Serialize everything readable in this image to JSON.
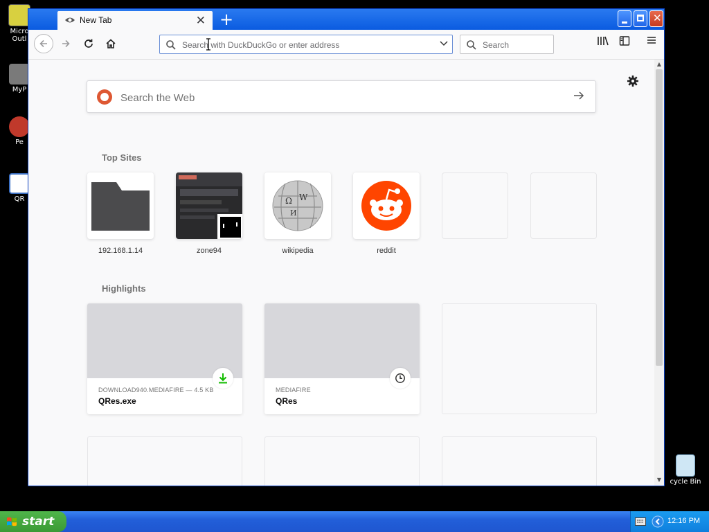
{
  "desktop": {
    "icons": [
      {
        "label": "Micro\nOutl",
        "color": "#d8d040"
      },
      {
        "label": "MyP",
        "color": "#7a7a7a"
      },
      {
        "label": "Pe",
        "color": "#c0392b"
      },
      {
        "label": "QR",
        "color": "#3b6fc2"
      }
    ],
    "recycle_label": "cycle Bin"
  },
  "browser": {
    "tab_title": "New Tab",
    "url_placeholder": "Search with DuckDuckGo or enter address",
    "search_placeholder": "Search"
  },
  "newtab": {
    "web_search_placeholder": "Search the Web",
    "top_sites_title": "Top Sites",
    "top_sites": [
      {
        "label": "192.168.1.14",
        "kind": "folder"
      },
      {
        "label": "zone94",
        "kind": "screenshot"
      },
      {
        "label": "wikipedia",
        "kind": "wikipedia"
      },
      {
        "label": "reddit",
        "kind": "reddit"
      },
      {
        "label": "",
        "kind": "empty"
      },
      {
        "label": "",
        "kind": "empty"
      }
    ],
    "highlights_title": "Highlights",
    "highlights": [
      {
        "source": "DOWNLOAD940.MEDIAFIRE — 4.5 KB",
        "title": "QRes.exe",
        "badge": "download-icon"
      },
      {
        "source": "MEDIAFIRE",
        "title": "QRes",
        "badge": "history-icon"
      }
    ]
  },
  "taskbar": {
    "start_label": "start",
    "clock": "12:16 PM"
  },
  "colors": {
    "titlebar": "#0a5be0",
    "reddit": "#ff4500",
    "duckduckgo": "#de5833",
    "download_green": "#12bc00"
  }
}
